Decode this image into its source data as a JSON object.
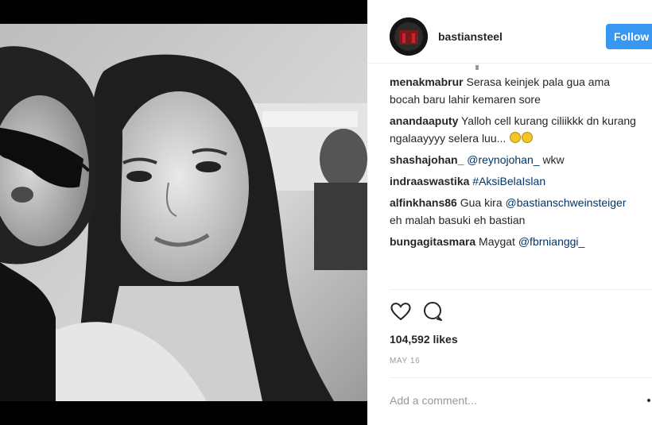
{
  "post": {
    "username": "bastiansteel",
    "follow_label": "Follow",
    "likes": "104,592 likes",
    "date": "MAY 16",
    "comment_placeholder": "Add a comment..."
  },
  "comments": [
    {
      "user": "menakmabrur",
      "text": "Serasa keinjek pala gua ama bocah baru lahir kemaren sore"
    },
    {
      "user": "anandaaputy",
      "text": "Yalloh cell kurang ciliikkk dn kurang ngalaayyyy selera luu...",
      "emoji": "😂😂"
    },
    {
      "user": "shashajohan_",
      "mention": "@reynojohan_",
      "text_after": "wkw"
    },
    {
      "user": "indraaswastika",
      "hashtag": "#AksiBelaIslan"
    },
    {
      "user": "alfinkhans86",
      "text": "Gua kira",
      "mention": "@bastianschweinsteiger",
      "text_after": "eh malah basuki eh bastian"
    },
    {
      "user": "bungagitasmara",
      "text": "Maygat",
      "mention": "@fbrnianggi_"
    }
  ],
  "icons": {
    "like": "heart-icon",
    "comment": "comment-icon",
    "options": "more-options-icon"
  },
  "colors": {
    "follow_button": "#3897f0",
    "link": "#003569",
    "muted": "#999999"
  }
}
